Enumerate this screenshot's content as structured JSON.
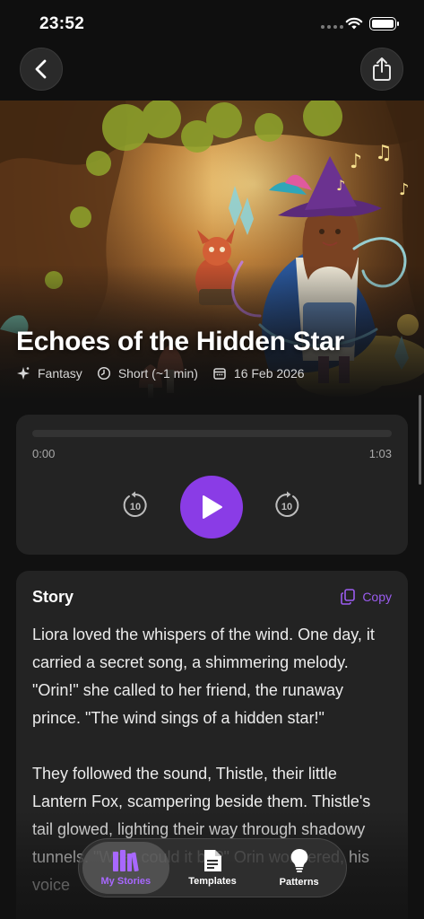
{
  "status": {
    "time": "23:52"
  },
  "nav": {
    "back_icon": "chevron-left-icon",
    "share_icon": "share-icon"
  },
  "story": {
    "title": "Echoes of the Hidden Star",
    "genre": "Fantasy",
    "length": "Short (~1 min)",
    "date": "16 Feb 2026"
  },
  "player": {
    "current_time": "0:00",
    "duration": "1:03",
    "progress": 0,
    "skip_back_label": "10",
    "skip_forward_label": "10"
  },
  "story_card": {
    "heading": "Story",
    "copy_label": "Copy",
    "paragraphs": [
      "Liora loved the whispers of the wind. One day, it carried a secret song, a shimmering melody. \"Orin!\" she called to her friend, the runaway prince. \"The wind sings of a hidden star!\"",
      "They followed the sound, Thistle, their little Lantern Fox, scampering beside them. Thistle's tail glowed, lighting their way through shadowy tunnels. \"What could it be?\" Orin wondered, his voice"
    ]
  },
  "tabs": [
    {
      "label": "My Stories",
      "icon": "books-icon",
      "active": true
    },
    {
      "label": "Templates",
      "icon": "document-icon",
      "active": false
    },
    {
      "label": "Patterns",
      "icon": "lightbulb-icon",
      "active": false
    }
  ],
  "colors": {
    "accent": "#8a3ce6",
    "accent_text": "#9b5cf0",
    "card": "#232323",
    "background": "#111111"
  }
}
